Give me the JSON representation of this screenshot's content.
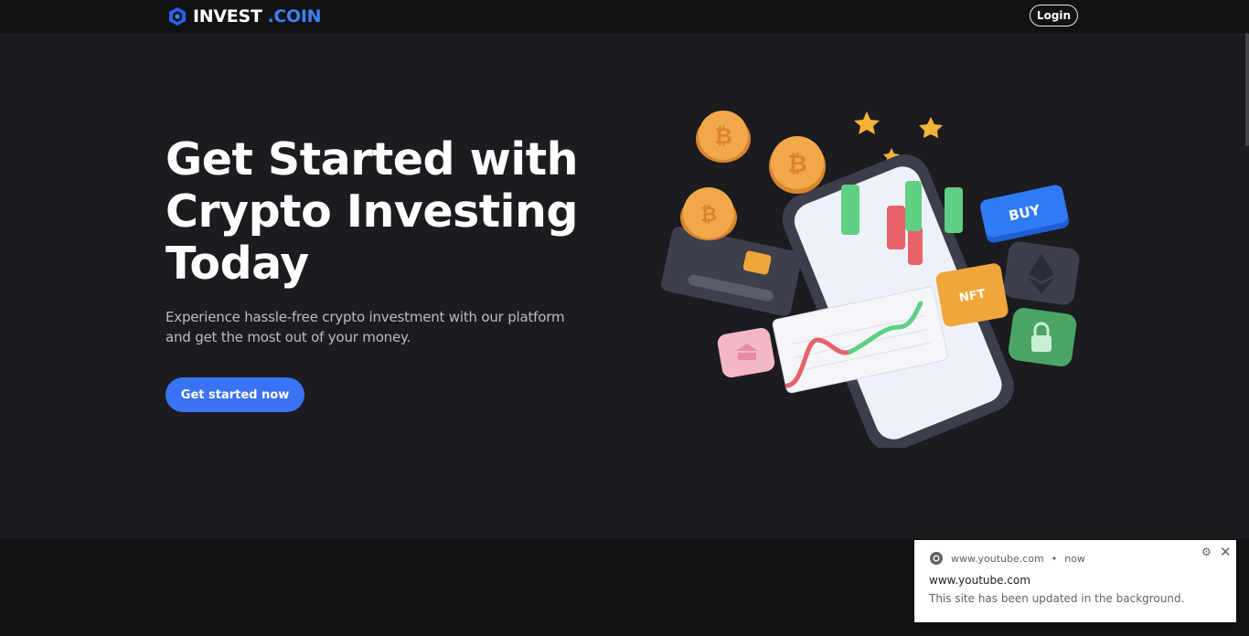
{
  "header": {
    "brand_part1": "INVEST",
    "brand_part2": ".COIN",
    "login_label": "Login"
  },
  "hero": {
    "title_lines": [
      "Get Started with",
      "Crypto Investing",
      "Today"
    ],
    "subtitle_lines": [
      "Experience hassle-free crypto investment with our platform",
      "and get the most out of your money."
    ],
    "cta_label": "Get started now"
  },
  "illustration": {
    "buy_label": "BUY",
    "nft_label": "NFT"
  },
  "notification": {
    "source": "www.youtube.com",
    "time": "now",
    "title": "www.youtube.com",
    "body": "This site has been updated in the background."
  },
  "colors": {
    "background": "#1b1b20",
    "accent": "#3b73f5",
    "brand_accent": "#3b82f6"
  },
  "icons": {
    "brand": "cube-logo-icon",
    "notification_source": "chrome-icon",
    "settings": "gear-icon",
    "close": "close-icon"
  }
}
